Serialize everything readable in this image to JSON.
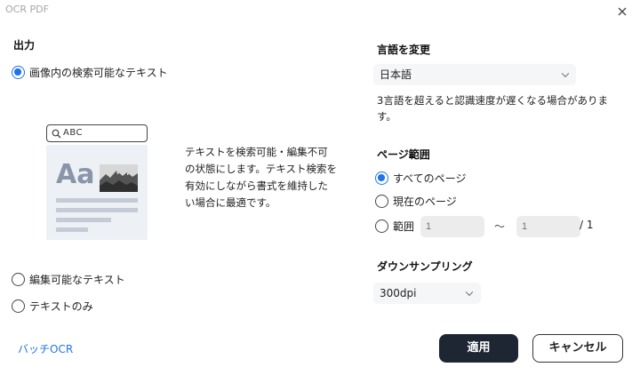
{
  "window": {
    "title": "OCR PDF"
  },
  "output": {
    "heading": "出力",
    "options": [
      {
        "label": "画像内の検索可能なテキスト",
        "checked": true
      },
      {
        "label": "編集可能なテキスト",
        "checked": false
      },
      {
        "label": "テキストのみ",
        "checked": false
      }
    ],
    "preview": {
      "search_text": "ABC",
      "sample_text": "Aa"
    },
    "description": "テキストを検索可能・編集不可の状態にします。テキスト検索を有効にしながら書式を維持したい場合に最適です。"
  },
  "language": {
    "heading": "言語を変更",
    "selected": "日本語",
    "note": "3言語を超えると認識速度が遅くなる場合があります。"
  },
  "page_range": {
    "heading": "ページ範囲",
    "options": [
      {
        "label": "すべてのページ",
        "checked": true
      },
      {
        "label": "現在のページ",
        "checked": false
      },
      {
        "label": "範囲",
        "checked": false
      }
    ],
    "from_placeholder": "1",
    "separator": "～",
    "to_placeholder": "1",
    "total": "/ 1"
  },
  "downsampling": {
    "heading": "ダウンサンプリング",
    "selected": "300dpi"
  },
  "footer": {
    "batch_link": "バッチOCR",
    "apply_label": "適用",
    "cancel_label": "キャンセル"
  },
  "colors": {
    "accent": "#1f74e8",
    "primary_button": "#1e2533",
    "link": "#1f74e8"
  }
}
